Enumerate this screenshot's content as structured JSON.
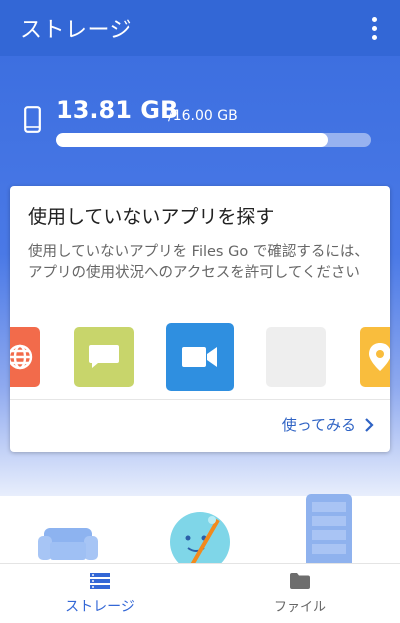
{
  "app_bar": {
    "title": "ストレージ",
    "more_icon": "more-vert-icon"
  },
  "storage": {
    "used": "13.81 GB",
    "total": "/16.00 GB",
    "used_fraction": 0.863,
    "device_icon": "phone-icon"
  },
  "card": {
    "title": "使用していないアプリを探す",
    "description": "使用していないアプリを Files Go で確認するには、アプリの使用状況へのアクセスを許可してください",
    "apps": [
      {
        "icon": "globe-icon",
        "color": "#f26b4b"
      },
      {
        "icon": "chat-bubble-icon",
        "color": "#c8d56b"
      },
      {
        "icon": "video-camera-icon",
        "color": "#2f8fe0"
      },
      {
        "icon": "blank-app-icon",
        "color": "#eeeeee"
      },
      {
        "icon": "map-pin-icon",
        "color": "#f9bd3d"
      }
    ],
    "action_label": "使ってみる",
    "action_icon": "chevron-right-icon"
  },
  "bottom_nav": {
    "items": [
      {
        "label": "ストレージ",
        "icon": "storage-icon",
        "active": true
      },
      {
        "label": "ファイル",
        "icon": "folder-icon",
        "active": false
      }
    ]
  },
  "colors": {
    "primary": "#3367d6",
    "accent_text": "#2f63c4"
  }
}
